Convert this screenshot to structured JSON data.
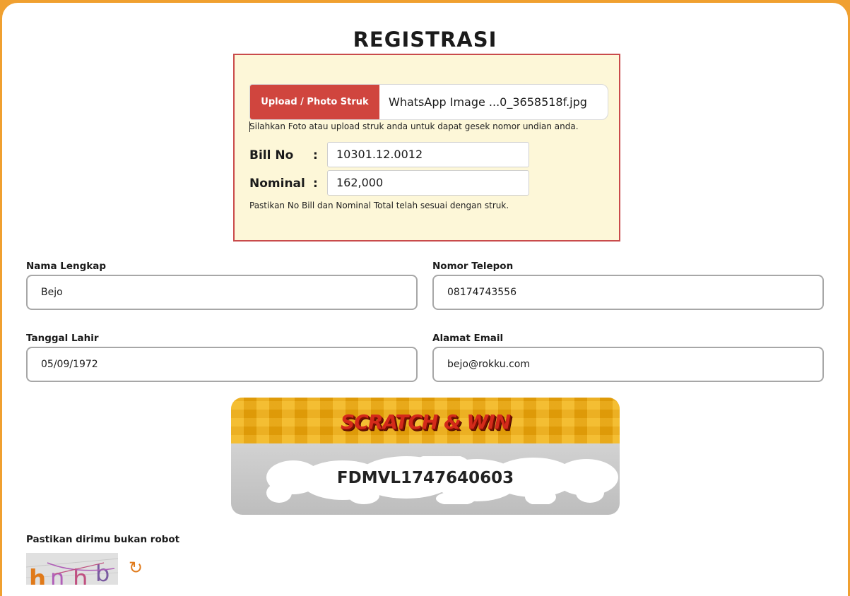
{
  "page": {
    "title": "REGISTRASI"
  },
  "receipt": {
    "upload_button_label": "Upload / Photo Struk",
    "uploaded_file_name": "WhatsApp Image ...0_3658518f.jpg",
    "upload_hint": "Silahkan Foto atau upload struk anda untuk dapat gesek nomor undian anda.",
    "bill_no_label": "Bill No",
    "bill_no_value": "10301.12.0012",
    "nominal_label": "Nominal",
    "nominal_value": "162,000",
    "colon": ":",
    "confirm_hint": "Pastikan No Bill dan Nominal Total telah sesuai dengan struk."
  },
  "form": {
    "full_name": {
      "label": "Nama Lengkap",
      "value": "Bejo"
    },
    "phone": {
      "label": "Nomor Telepon",
      "value": "08174743556"
    },
    "birth_date": {
      "label": "Tanggal Lahir",
      "value": "05/09/1972"
    },
    "email": {
      "label": "Alamat Email",
      "value": "bejo@rokku.com"
    }
  },
  "scratch_card": {
    "title": "SCRATCH & WIN",
    "code": "FDMVL1747640603"
  },
  "captcha": {
    "label": "Pastikan dirimu bukan robot",
    "text": "hnhb",
    "refresh_icon": "refresh-icon"
  },
  "colors": {
    "background": "#f0a030",
    "accent_red": "#d0453e",
    "receipt_bg": "#fdf7d8",
    "scratch_gold": "#e9a50e",
    "refresh_orange": "#e07a1a"
  }
}
